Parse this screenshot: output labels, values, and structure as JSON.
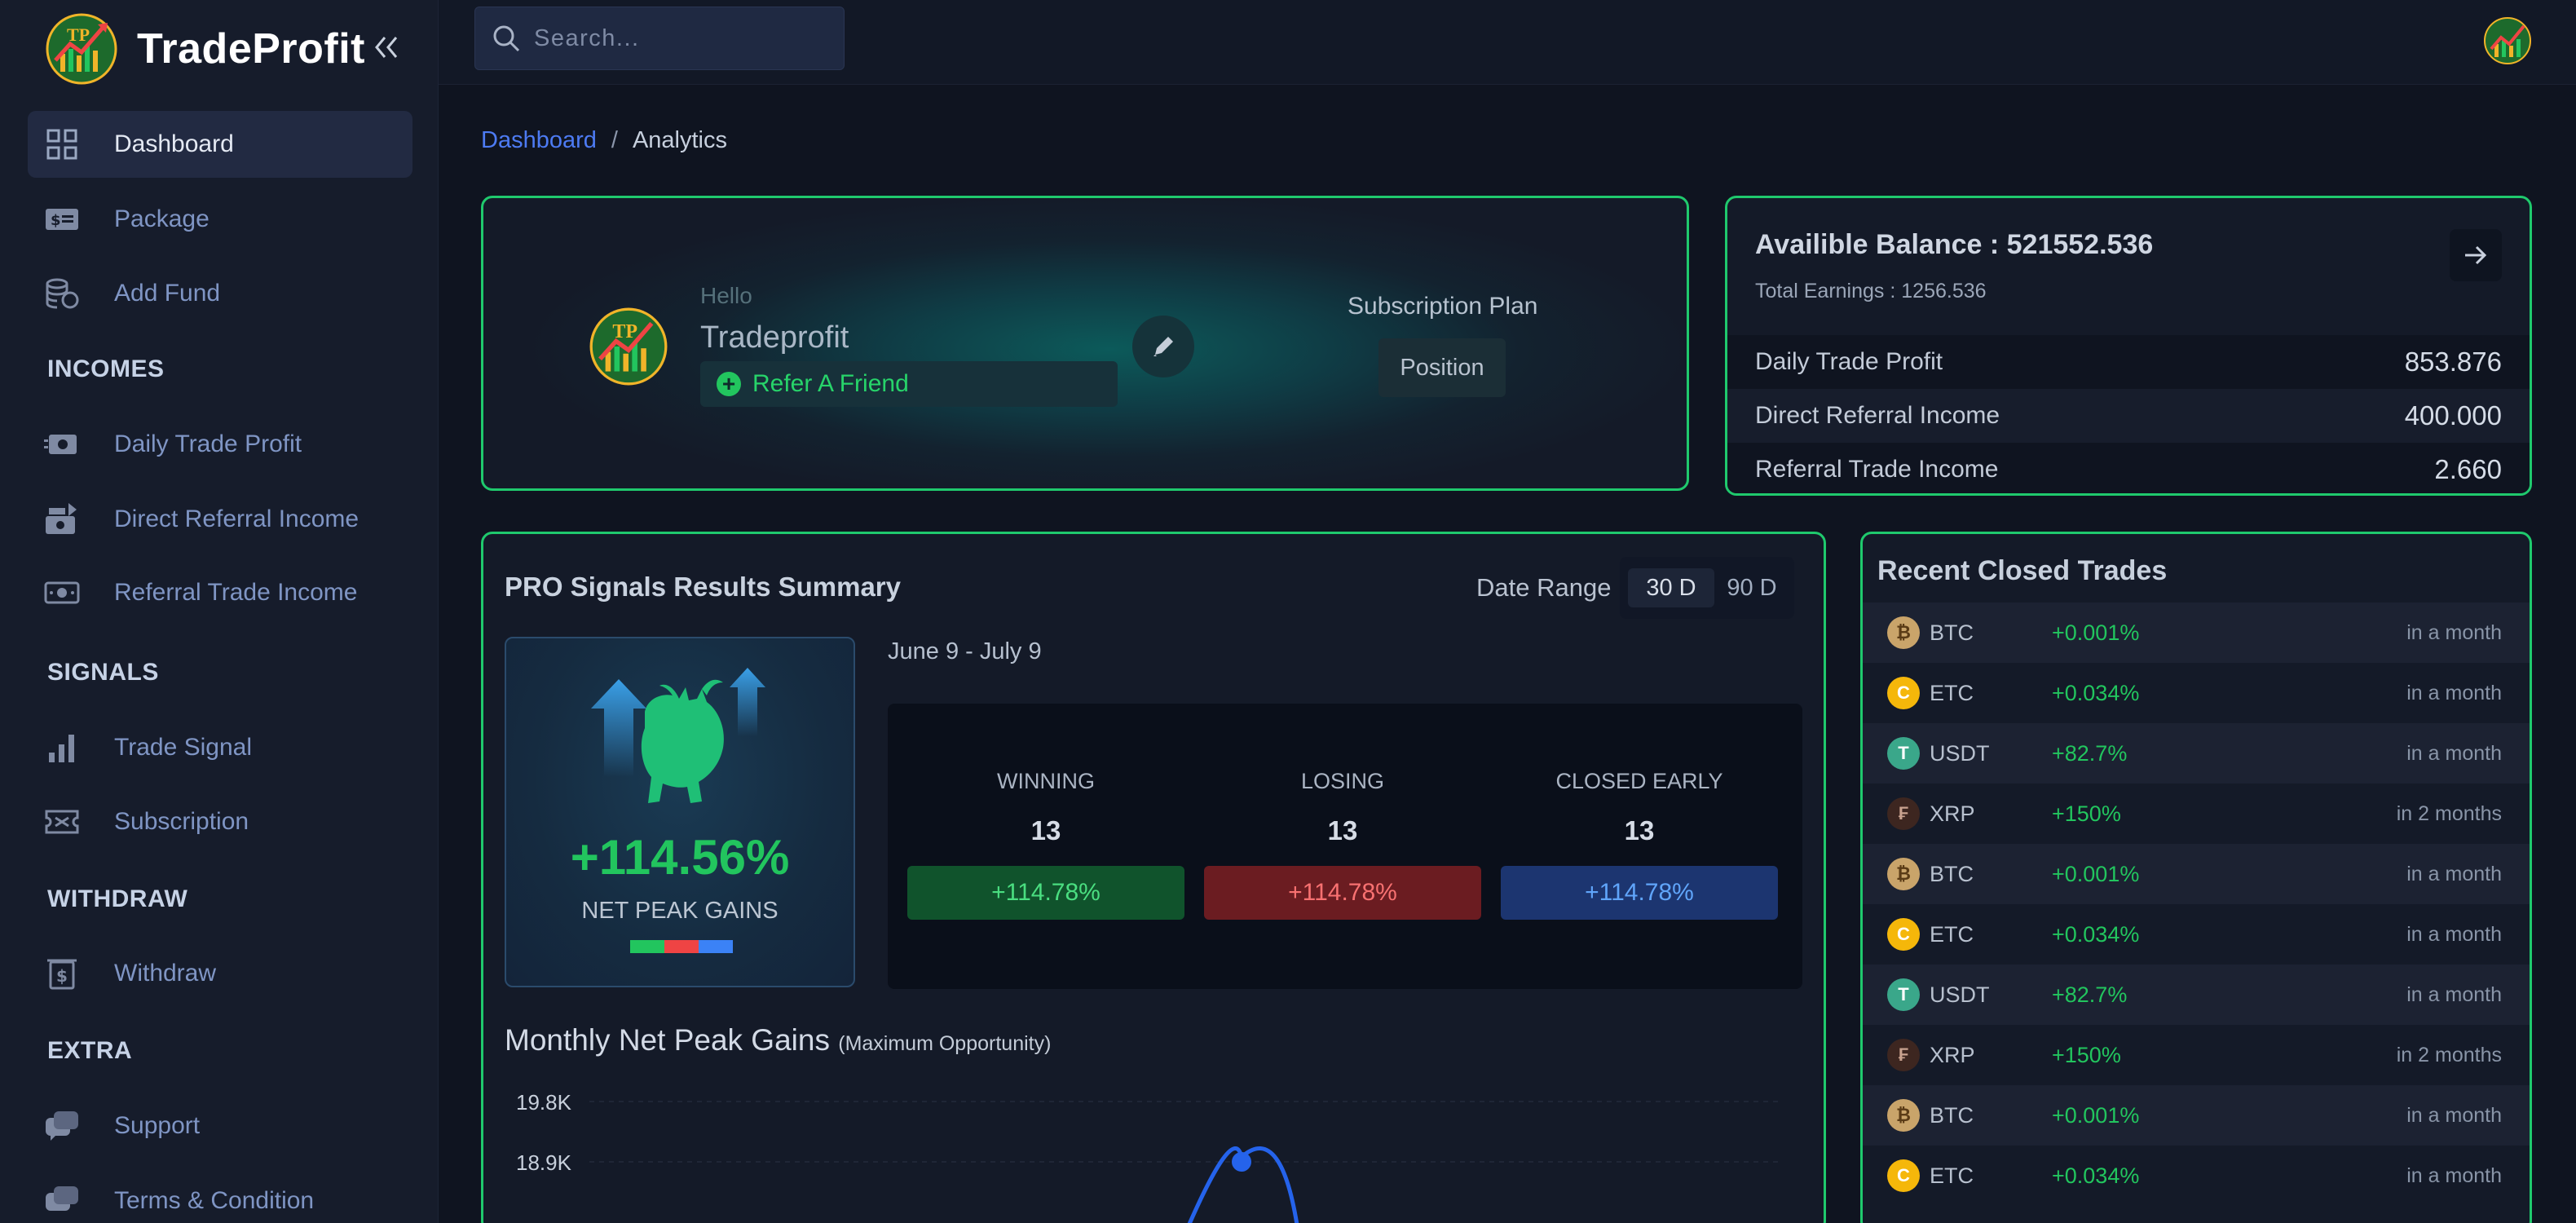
{
  "brand": {
    "name": "TradeProfit",
    "collapse_icon": "double-chevron-left-icon"
  },
  "search": {
    "placeholder": "Search..."
  },
  "sidebar": {
    "items": [
      {
        "label": "Dashboard",
        "icon": "grid-icon",
        "active": true
      },
      {
        "label": "Package",
        "icon": "money-icon"
      },
      {
        "label": "Add Fund",
        "icon": "coins-stack-icon"
      }
    ],
    "incomes": {
      "title": "INCOMES",
      "items": [
        {
          "label": "Daily Trade Profit",
          "icon": "cash-flow-icon"
        },
        {
          "label": "Direct Referral Income",
          "icon": "cash-stack-icon"
        },
        {
          "label": "Referral Trade Income",
          "icon": "money-exchange-icon"
        }
      ]
    },
    "signals": {
      "title": "SIGNALS",
      "items": [
        {
          "label": "Trade Signal",
          "icon": "bar-chart-icon"
        },
        {
          "label": "Subscription",
          "icon": "ticket-icon"
        }
      ]
    },
    "withdraw": {
      "title": "WITHDRAW",
      "items": [
        {
          "label": "Withdraw",
          "icon": "withdraw-icon"
        }
      ]
    },
    "extra": {
      "title": "EXTRA",
      "items": [
        {
          "label": "Support",
          "icon": "chat-icon"
        },
        {
          "label": "Terms & Condition",
          "icon": "document-icon"
        }
      ]
    }
  },
  "breadcrumb": {
    "link": "Dashboard",
    "separator": "/",
    "current": "Analytics"
  },
  "hello": {
    "greeting": "Hello",
    "username": "Tradeprofit",
    "refer_label": "Refer A Friend",
    "subscription_title": "Subscription Plan",
    "subscription_value": "Position"
  },
  "balance": {
    "title": "Availible Balance : 521552.536",
    "total_earnings": "Total Earnings : 1256.536",
    "rows": [
      {
        "label": "Daily Trade Profit",
        "value": "853.876"
      },
      {
        "label": "Direct Referral Income",
        "value": "400.000"
      },
      {
        "label": "Referral Trade Income",
        "value": "2.660"
      }
    ]
  },
  "signals": {
    "title": "PRO Signals Results Summary",
    "date_range_label": "Date Range",
    "range_options": [
      "30 D",
      "90 D"
    ],
    "selected_range": "30 D",
    "period": "June 9 - July 9",
    "net_peak_gain": "+114.56%",
    "net_peak_label": "NET PEAK GAINS",
    "stats": [
      {
        "label": "WINNING",
        "count": "13",
        "pct": "+114.78%",
        "color": "#22c55e"
      },
      {
        "label": "LOSING",
        "count": "13",
        "pct": "+114.78%",
        "color": "#ef4444"
      },
      {
        "label": "CLOSED EARLY",
        "count": "13",
        "pct": "+114.78%",
        "color": "#3b82f6"
      }
    ],
    "monthly_title": "Monthly Net Peak Gains",
    "monthly_subtitle": "(Maximum Opportunity)"
  },
  "chart_data": {
    "type": "line",
    "title": "Monthly Net Peak Gains",
    "yticks": [
      "19.8K",
      "18.9K"
    ],
    "series": [
      {
        "values": [
          18.9
        ]
      }
    ],
    "grid": true
  },
  "trades": {
    "title": "Recent Closed Trades",
    "rows": [
      {
        "coin": "BTC",
        "change": "+0.001%",
        "when": "in a month"
      },
      {
        "coin": "ETC",
        "change": "+0.034%",
        "when": "in a month"
      },
      {
        "coin": "USDT",
        "change": "+82.7%",
        "when": "in a month"
      },
      {
        "coin": "XRP",
        "change": "+150%",
        "when": "in 2 months"
      },
      {
        "coin": "BTC",
        "change": "+0.001%",
        "when": "in a month"
      },
      {
        "coin": "ETC",
        "change": "+0.034%",
        "when": "in a month"
      },
      {
        "coin": "USDT",
        "change": "+82.7%",
        "when": "in a month"
      },
      {
        "coin": "XRP",
        "change": "+150%",
        "when": "in 2 months"
      },
      {
        "coin": "BTC",
        "change": "+0.001%",
        "when": "in a month"
      },
      {
        "coin": "ETC",
        "change": "+0.034%",
        "when": "in a month"
      }
    ]
  },
  "colors": {
    "accent": "#1fc96d",
    "link": "#4d7bf3",
    "win": "#22c55e",
    "lose": "#ef4444",
    "early": "#3b82f6"
  }
}
